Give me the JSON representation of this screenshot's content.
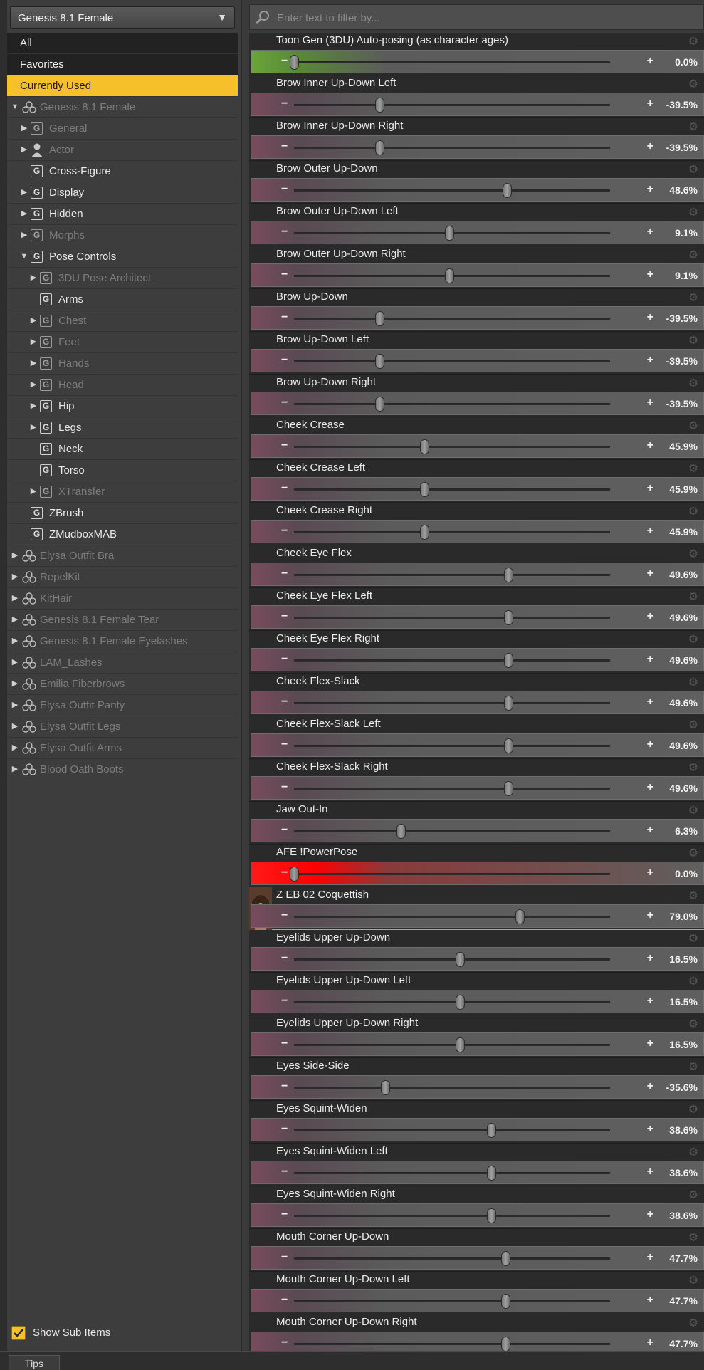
{
  "figure_selector": {
    "value": "Genesis 8.1 Female"
  },
  "filter": {
    "placeholder": "Enter text to filter by..."
  },
  "tree": [
    {
      "label": "All",
      "type": "category"
    },
    {
      "label": "Favorites",
      "type": "category"
    },
    {
      "label": "Currently Used",
      "type": "category",
      "selected": true
    },
    {
      "label": "Genesis 8.1 Female",
      "type": "figure",
      "level": 0,
      "twisty": "down",
      "dim": true
    },
    {
      "label": "General",
      "type": "group",
      "level": 1,
      "twisty": "right",
      "dim": true
    },
    {
      "label": "Actor",
      "type": "actor",
      "level": 1,
      "twisty": "right",
      "dim": true
    },
    {
      "label": "Cross-Figure",
      "type": "group",
      "level": 1,
      "twisty": "none",
      "dim": false
    },
    {
      "label": "Display",
      "type": "group",
      "level": 1,
      "twisty": "right",
      "dim": false
    },
    {
      "label": "Hidden",
      "type": "group",
      "level": 1,
      "twisty": "right",
      "dim": false
    },
    {
      "label": "Morphs",
      "type": "group",
      "level": 1,
      "twisty": "right",
      "dim": true
    },
    {
      "label": "Pose Controls",
      "type": "group",
      "level": 1,
      "twisty": "down",
      "dim": false
    },
    {
      "label": "3DU Pose Architect",
      "type": "group",
      "level": 2,
      "twisty": "right",
      "dim": true
    },
    {
      "label": "Arms",
      "type": "group",
      "level": 2,
      "twisty": "none",
      "dim": false
    },
    {
      "label": "Chest",
      "type": "group",
      "level": 2,
      "twisty": "right",
      "dim": true
    },
    {
      "label": "Feet",
      "type": "group",
      "level": 2,
      "twisty": "right",
      "dim": true
    },
    {
      "label": "Hands",
      "type": "group",
      "level": 2,
      "twisty": "right",
      "dim": true
    },
    {
      "label": "Head",
      "type": "group",
      "level": 2,
      "twisty": "right",
      "dim": true
    },
    {
      "label": "Hip",
      "type": "group",
      "level": 2,
      "twisty": "right",
      "dim": false
    },
    {
      "label": "Legs",
      "type": "group",
      "level": 2,
      "twisty": "right",
      "dim": false
    },
    {
      "label": "Neck",
      "type": "group",
      "level": 2,
      "twisty": "none",
      "dim": false
    },
    {
      "label": "Torso",
      "type": "group",
      "level": 2,
      "twisty": "none",
      "dim": false
    },
    {
      "label": "XTransfer",
      "type": "group",
      "level": 2,
      "twisty": "right",
      "dim": true
    },
    {
      "label": "ZBrush",
      "type": "group",
      "level": 1,
      "twisty": "none",
      "dim": false
    },
    {
      "label": "ZMudboxMAB",
      "type": "group",
      "level": 1,
      "twisty": "none",
      "dim": false
    },
    {
      "label": "Elysa Outfit Bra",
      "type": "figure",
      "level": 0,
      "twisty": "right",
      "dim": true
    },
    {
      "label": "RepelKit",
      "type": "figure",
      "level": 0,
      "twisty": "right",
      "dim": true
    },
    {
      "label": "KitHair",
      "type": "figure",
      "level": 0,
      "twisty": "right",
      "dim": true
    },
    {
      "label": "Genesis 8.1 Female Tear",
      "type": "figure",
      "level": 0,
      "twisty": "right",
      "dim": true
    },
    {
      "label": "Genesis 8.1 Female Eyelashes",
      "type": "figure",
      "level": 0,
      "twisty": "right",
      "dim": true
    },
    {
      "label": "LAM_Lashes",
      "type": "figure",
      "level": 0,
      "twisty": "right",
      "dim": true
    },
    {
      "label": "Emilia Fiberbrows",
      "type": "figure",
      "level": 0,
      "twisty": "right",
      "dim": true
    },
    {
      "label": "Elysa Outfit Panty",
      "type": "figure",
      "level": 0,
      "twisty": "right",
      "dim": true
    },
    {
      "label": "Elysa Outfit Legs",
      "type": "figure",
      "level": 0,
      "twisty": "right",
      "dim": true
    },
    {
      "label": "Elysa Outfit Arms",
      "type": "figure",
      "level": 0,
      "twisty": "right",
      "dim": true
    },
    {
      "label": "Blood Oath Boots",
      "type": "figure",
      "level": 0,
      "twisty": "right",
      "dim": true
    }
  ],
  "show_sub_items": {
    "label": "Show Sub Items",
    "checked": true
  },
  "properties": [
    {
      "name": "Toon Gen (3DU) Auto-posing (as character ages)",
      "value": "0.0%",
      "pos": 0.0,
      "style": "green"
    },
    {
      "name": "Brow Inner Up-Down Left",
      "value": "-39.5%",
      "pos": 0.27
    },
    {
      "name": "Brow Inner Up-Down Right",
      "value": "-39.5%",
      "pos": 0.27
    },
    {
      "name": "Brow Outer Up-Down",
      "value": "48.6%",
      "pos": 0.674
    },
    {
      "name": "Brow Outer Up-Down Left",
      "value": "9.1%",
      "pos": 0.491
    },
    {
      "name": "Brow Outer Up-Down Right",
      "value": "9.1%",
      "pos": 0.491
    },
    {
      "name": "Brow Up-Down",
      "value": "-39.5%",
      "pos": 0.27
    },
    {
      "name": "Brow Up-Down Left",
      "value": "-39.5%",
      "pos": 0.27
    },
    {
      "name": "Brow Up-Down Right",
      "value": "-39.5%",
      "pos": 0.27
    },
    {
      "name": "Cheek Crease",
      "value": "45.9%",
      "pos": 0.412
    },
    {
      "name": "Cheek Crease Left",
      "value": "45.9%",
      "pos": 0.412
    },
    {
      "name": "Cheek Crease Right",
      "value": "45.9%",
      "pos": 0.412
    },
    {
      "name": "Cheek Eye Flex",
      "value": "49.6%",
      "pos": 0.678
    },
    {
      "name": "Cheek Eye Flex Left",
      "value": "49.6%",
      "pos": 0.678
    },
    {
      "name": "Cheek Eye Flex Right",
      "value": "49.6%",
      "pos": 0.678
    },
    {
      "name": "Cheek Flex-Slack",
      "value": "49.6%",
      "pos": 0.678
    },
    {
      "name": "Cheek Flex-Slack Left",
      "value": "49.6%",
      "pos": 0.678
    },
    {
      "name": "Cheek Flex-Slack Right",
      "value": "49.6%",
      "pos": 0.678
    },
    {
      "name": "Jaw Out-In",
      "value": "6.3%",
      "pos": 0.338
    },
    {
      "name": "AFE !PowerPose",
      "value": "0.0%",
      "pos": 0.0,
      "style": "red"
    },
    {
      "name": "Z EB 02 Coquettish",
      "value": "79.0%",
      "pos": 0.714,
      "thumb": true
    },
    {
      "name": "Eyelids Upper Up-Down",
      "value": "16.5%",
      "pos": 0.525
    },
    {
      "name": "Eyelids Upper Up-Down Left",
      "value": "16.5%",
      "pos": 0.525
    },
    {
      "name": "Eyelids Upper Up-Down Right",
      "value": "16.5%",
      "pos": 0.525
    },
    {
      "name": "Eyes Side-Side",
      "value": "-35.6%",
      "pos": 0.288
    },
    {
      "name": "Eyes Squint-Widen",
      "value": "38.6%",
      "pos": 0.624
    },
    {
      "name": "Eyes Squint-Widen Left",
      "value": "38.6%",
      "pos": 0.624
    },
    {
      "name": "Eyes Squint-Widen Right",
      "value": "38.6%",
      "pos": 0.624
    },
    {
      "name": "Mouth Corner Up-Down",
      "value": "47.7%",
      "pos": 0.668
    },
    {
      "name": "Mouth Corner Up-Down Left",
      "value": "47.7%",
      "pos": 0.668
    },
    {
      "name": "Mouth Corner Up-Down Right",
      "value": "47.7%",
      "pos": 0.668
    }
  ],
  "bottom_tab": {
    "label": "Tips"
  },
  "colors": {
    "accent": "#f5c02a",
    "green_fill": "#6aa43a",
    "red_fill": "#ff0000",
    "slider_tint": "#7a4b5d"
  }
}
